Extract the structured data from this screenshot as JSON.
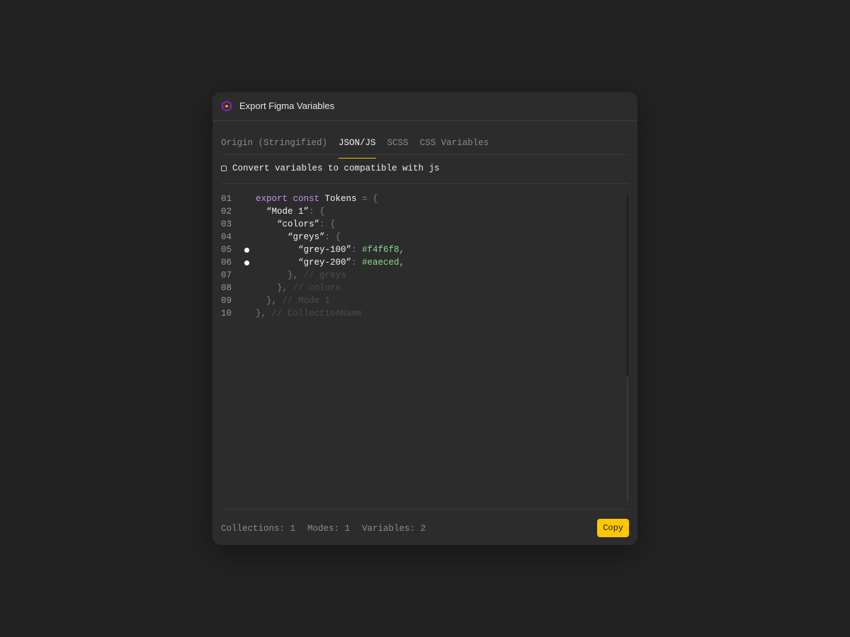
{
  "window": {
    "title": "Export Figma Variables",
    "icon": "hexagon-logo-icon"
  },
  "tabs": [
    {
      "label": "Origin (Stringified)",
      "active": false
    },
    {
      "label": "JSON/JS",
      "active": true
    },
    {
      "label": "SCSS",
      "active": false
    },
    {
      "label": "CSS Variables",
      "active": false
    }
  ],
  "option": {
    "checked": false,
    "label": "Convert variables to compatible with js"
  },
  "code": {
    "line_numbers": [
      "01",
      "02",
      "03",
      "04",
      "05",
      "06",
      "07",
      "08",
      "09",
      "10"
    ],
    "lines": [
      {
        "indent": "",
        "parts": [
          {
            "t": "export const",
            "c": "kw"
          },
          {
            "t": " Tokens ",
            "c": "id"
          },
          {
            "t": "= {",
            "c": "pn"
          }
        ]
      },
      {
        "indent": "  ",
        "parts": [
          {
            "t": "“Mode 1”",
            "c": "str"
          },
          {
            "t": ": {",
            "c": "pn"
          }
        ]
      },
      {
        "indent": "    ",
        "parts": [
          {
            "t": "“colors”",
            "c": "str"
          },
          {
            "t": ": {",
            "c": "pn"
          }
        ]
      },
      {
        "indent": "      ",
        "parts": [
          {
            "t": "“greys”",
            "c": "str"
          },
          {
            "t": ": {",
            "c": "pn"
          }
        ]
      },
      {
        "indent": "        ",
        "marker": true,
        "parts": [
          {
            "t": "“grey-100”",
            "c": "str"
          },
          {
            "t": ": ",
            "c": "pn"
          },
          {
            "t": "#f4f6f8,",
            "c": "val"
          }
        ]
      },
      {
        "indent": "        ",
        "marker": true,
        "parts": [
          {
            "t": "“grey-200”",
            "c": "str"
          },
          {
            "t": ": ",
            "c": "pn"
          },
          {
            "t": "#eaeced,",
            "c": "val"
          }
        ]
      },
      {
        "indent": "      ",
        "parts": [
          {
            "t": "},",
            "c": "pn"
          },
          {
            "t": " // greys",
            "c": "cm"
          }
        ]
      },
      {
        "indent": "    ",
        "parts": [
          {
            "t": "},",
            "c": "pn"
          },
          {
            "t": " // colors",
            "c": "cm"
          }
        ]
      },
      {
        "indent": "  ",
        "parts": [
          {
            "t": "},",
            "c": "pn"
          },
          {
            "t": " // Mode 1",
            "c": "cm"
          }
        ]
      },
      {
        "indent": "",
        "parts": [
          {
            "t": "},",
            "c": "pn"
          },
          {
            "t": " // CollectionName",
            "c": "cm"
          }
        ]
      }
    ]
  },
  "footer": {
    "collections": "Collections: 1",
    "modes": "Modes: 1",
    "variables": "Variables: 2",
    "copy_label": "Copy"
  },
  "colors": {
    "accent": "#ffc700",
    "background": "#222222",
    "panel": "#2c2c2c"
  }
}
